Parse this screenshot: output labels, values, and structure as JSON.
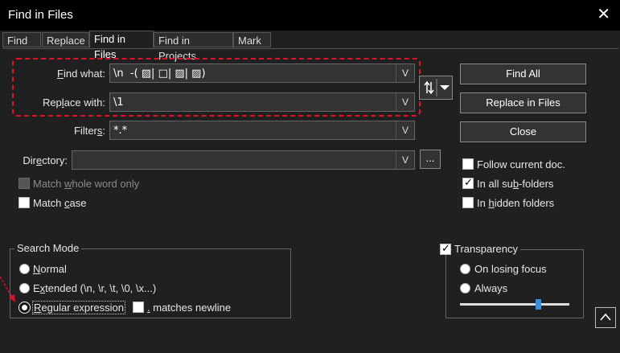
{
  "window": {
    "title": "Find in Files",
    "close": "✕"
  },
  "tabs": [
    "Find",
    "Replace",
    "Find in Files",
    "Find in Projects",
    "Mark"
  ],
  "fields": {
    "find_label_u": "F",
    "find_label_rest": "ind what:",
    "find_value": "\\n  -( ▨| □| ▨| ▨)",
    "replace_label_pre": "Rep",
    "replace_label_u": "l",
    "replace_label_rest": "ace with:",
    "replace_value": "\\1",
    "filters_label_pre": "Filter",
    "filters_label_u": "s",
    "filters_label_rest": ":",
    "filters_value": "*.*",
    "directory_label_pre": "Dir",
    "directory_label_u": "e",
    "directory_label_rest": "ctory:",
    "directory_value": "",
    "browse": "...",
    "dropdown_glyph": "V"
  },
  "buttons": {
    "find_all": "Find All",
    "replace_in_files": "Replace in Files",
    "close": "Close",
    "up": "^"
  },
  "options_left": {
    "whole_word_pre": "Match ",
    "whole_word_u": "w",
    "whole_word_rest": "hole word only",
    "match_case_pre": "Match ",
    "match_case_u": "c",
    "match_case_rest": "ase"
  },
  "options_right": {
    "follow_current": "Follow current doc.",
    "all_sub_pre": "In all su",
    "all_sub_u": "b",
    "all_sub_rest": "-folders",
    "hidden_pre": "In ",
    "hidden_u": "h",
    "hidden_rest": "idden folders"
  },
  "search_mode": {
    "title": "Search Mode",
    "normal_u": "N",
    "normal_rest": "ormal",
    "extended_pre": "E",
    "extended_u": "x",
    "extended_rest": "tended (\\n, \\r, \\t, \\0, \\x...)",
    "regex_u": "R",
    "regex_rest": "egular expression",
    "newline_u": ".",
    "newline_rest": " matches newline",
    "selected": "Regular expression"
  },
  "transparency": {
    "title": "Transparency",
    "on_losing_focus": "On losing focus",
    "always": "Always",
    "level": 0.72
  },
  "colors": {
    "background": "#202020",
    "title_bar": "#000000",
    "highlight_box": "#e0102a",
    "slider_thumb": "#3b8fd9"
  }
}
